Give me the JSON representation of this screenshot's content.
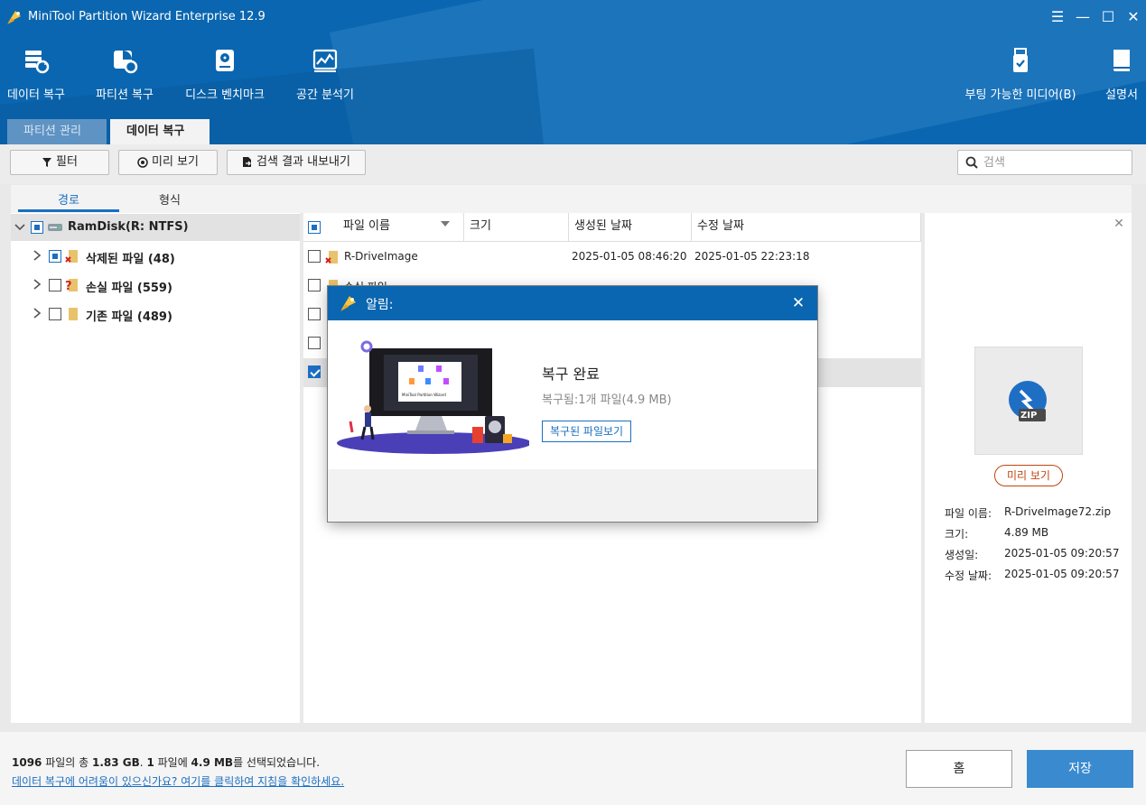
{
  "app": {
    "title": "MiniTool Partition Wizard Enterprise 12.9"
  },
  "window_controls": {
    "menu": "☰",
    "minimize": "—",
    "maximize": "☐",
    "close": "✕"
  },
  "toolbar": {
    "data_recovery": "데이터 복구",
    "partition_recovery": "파티션 복구",
    "disk_benchmark": "디스크 벤치마크",
    "space_analyzer": "공간 분석기",
    "bootable_media": "부팅 가능한 미디어(B)",
    "manual": "설명서"
  },
  "tabs": [
    {
      "label": "파티션 관리",
      "active": false
    },
    {
      "label": "데이터 복구",
      "active": true,
      "close": "✕"
    }
  ],
  "actions": {
    "filter": "필터",
    "preview": "미리 보기",
    "export": "검색 결과 내보내기",
    "search_placeholder": "검색"
  },
  "tree_tabs": {
    "path": "경로",
    "type": "형식"
  },
  "tree": {
    "root": "RamDisk(R: NTFS)",
    "children": [
      {
        "label": "삭제된 파일 (48)"
      },
      {
        "label": "손실 파일 (559)"
      },
      {
        "label": "기존 파일 (489)"
      }
    ]
  },
  "table": {
    "columns": {
      "name": "파일 이름",
      "size": "크기",
      "created": "생성된 날짜",
      "modified": "수정 날짜"
    },
    "rows": [
      {
        "name": "R-DriveImage",
        "size": "",
        "created": "2025-01-05 08:46:20",
        "modified": "2025-01-05 22:23:18"
      },
      {
        "name": "손실 파일",
        "size": "",
        "created": "",
        "modified": ""
      }
    ]
  },
  "preview_panel": {
    "close": "✕",
    "zip_label": "ZIP",
    "preview_button": "미리 보기",
    "info": [
      {
        "label": "파일 이름:",
        "value": "R-DriveImage72.zip"
      },
      {
        "label": "크기:",
        "value": "4.89 MB"
      },
      {
        "label": "생성일:",
        "value": "2025-01-05 09:20:57"
      },
      {
        "label": "수정 날짜:",
        "value": "2025-01-05 09:20:57"
      }
    ]
  },
  "footer": {
    "summary_count": "1096",
    "summary_t1": " 파일의 총 ",
    "summary_total": "1.83 GB",
    "summary_t2": ". ",
    "summary_sel": "1",
    "summary_t3": " 파일에 ",
    "summary_selsize": "4.9 MB",
    "summary_t4": "를 선택되었습니다.",
    "help_link": "데이터 복구에 어려움이 있으신가요? 여기를 클릭하여 지침을 확인하세요.",
    "home": "홈",
    "save": "저장"
  },
  "dialog": {
    "title": "알림:",
    "close": "✕",
    "heading": "복구 완료",
    "subtext": "복구됨:1개 파일(4.9 MB)",
    "link": "복구된 파일보기",
    "illustration_text": "MiniTool Partition Wizard"
  },
  "colors": {
    "brand": "#0a66b0",
    "accent": "#1a6fc2",
    "save": "#3a8ad0",
    "preview_orange": "#c1440e"
  }
}
